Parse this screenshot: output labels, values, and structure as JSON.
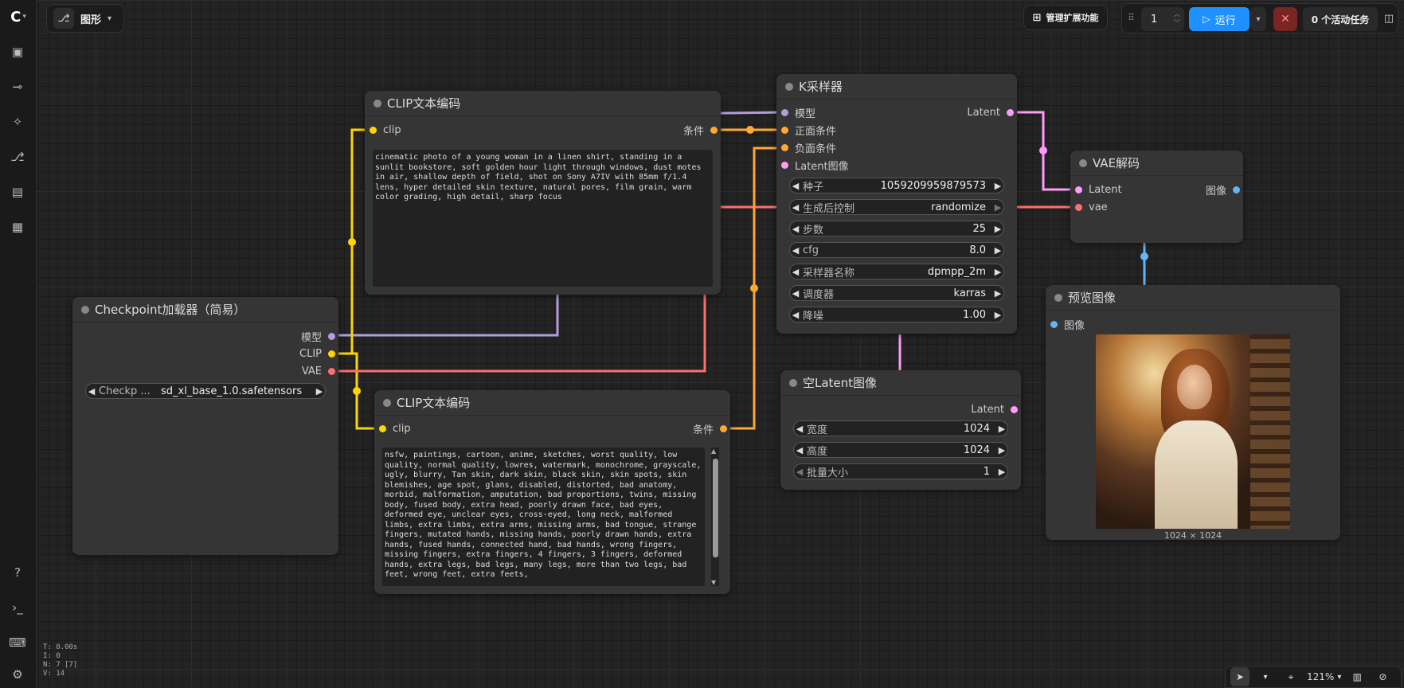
{
  "topbar": {
    "tab_label": "图形",
    "extensions_label": "管理扩展功能",
    "queue_count": "1",
    "run_label": "运行",
    "active_tasks_label": "0 个活动任务"
  },
  "stats": [
    "T: 0.00s",
    "I: 0",
    "N: 7 [7]",
    "V: 14"
  ],
  "nodes": {
    "clip_pos": {
      "title": "CLIP文本编码",
      "input": "clip",
      "output": "条件",
      "text": "cinematic photo of a young woman in a linen shirt, standing in a sunlit bookstore, soft golden hour light through windows, dust motes in air, shallow depth of field, shot on Sony A7IV with 85mm f/1.4 lens, hyper detailed skin texture, natural pores, film grain, warm color grading, high detail, sharp focus"
    },
    "clip_neg": {
      "title": "CLIP文本编码",
      "input": "clip",
      "output": "条件",
      "text": "nsfw, paintings, cartoon, anime, sketches, worst quality, low quality, normal quality, lowres, watermark, monochrome, grayscale, ugly, blurry, Tan skin, dark skin, black skin, skin spots, skin blemishes, age spot, glans, disabled, distorted, bad anatomy, morbid, malformation, amputation, bad proportions, twins, missing body, fused body, extra head, poorly drawn face, bad eyes, deformed eye, unclear eyes, cross-eyed, long neck, malformed limbs, extra limbs, extra arms, missing arms, bad tongue, strange fingers, mutated hands, missing hands, poorly drawn hands, extra hands, fused hands, connected hand, bad hands, wrong fingers, missing fingers, extra fingers, 4 fingers, 3 fingers, deformed hands, extra legs, bad legs, many legs, more than two legs, bad feet, wrong feet, extra feets,"
    },
    "checkpoint": {
      "title": "Checkpoint加载器（简易）",
      "outputs": [
        "模型",
        "CLIP",
        "VAE"
      ],
      "widget_label": "Checkp ...",
      "widget_value": "sd_xl_base_1.0.safetensors"
    },
    "ksampler": {
      "title": "K采样器",
      "inputs": [
        "模型",
        "正面条件",
        "负面条件",
        "Latent图像"
      ],
      "output": "Latent",
      "widgets": [
        {
          "label": "种子",
          "value": "1059209959879573"
        },
        {
          "label": "生成后控制",
          "value": "randomize"
        },
        {
          "label": "步数",
          "value": "25"
        },
        {
          "label": "cfg",
          "value": "8.0"
        },
        {
          "label": "采样器名称",
          "value": "dpmpp_2m"
        },
        {
          "label": "调度器",
          "value": "karras"
        },
        {
          "label": "降噪",
          "value": "1.00"
        }
      ]
    },
    "vae_decode": {
      "title": "VAE解码",
      "inputs": [
        "Latent",
        "vae"
      ],
      "output": "图像"
    },
    "empty_latent": {
      "title": "空Latent图像",
      "output": "Latent",
      "widgets": [
        {
          "label": "宽度",
          "value": "1024"
        },
        {
          "label": "高度",
          "value": "1024"
        },
        {
          "label": "批量大小",
          "value": "1"
        }
      ]
    },
    "preview": {
      "title": "预览图像",
      "input": "图像",
      "size_label": "1024 × 1024"
    }
  },
  "bottom": {
    "zoom": "121%"
  },
  "colors": {
    "model": "#b39ddb",
    "clip": "#ffd500",
    "vae": "#ff6e6e",
    "conditioning": "#ffa931",
    "latent": "#ff9cf9",
    "image": "#64b5f6"
  }
}
